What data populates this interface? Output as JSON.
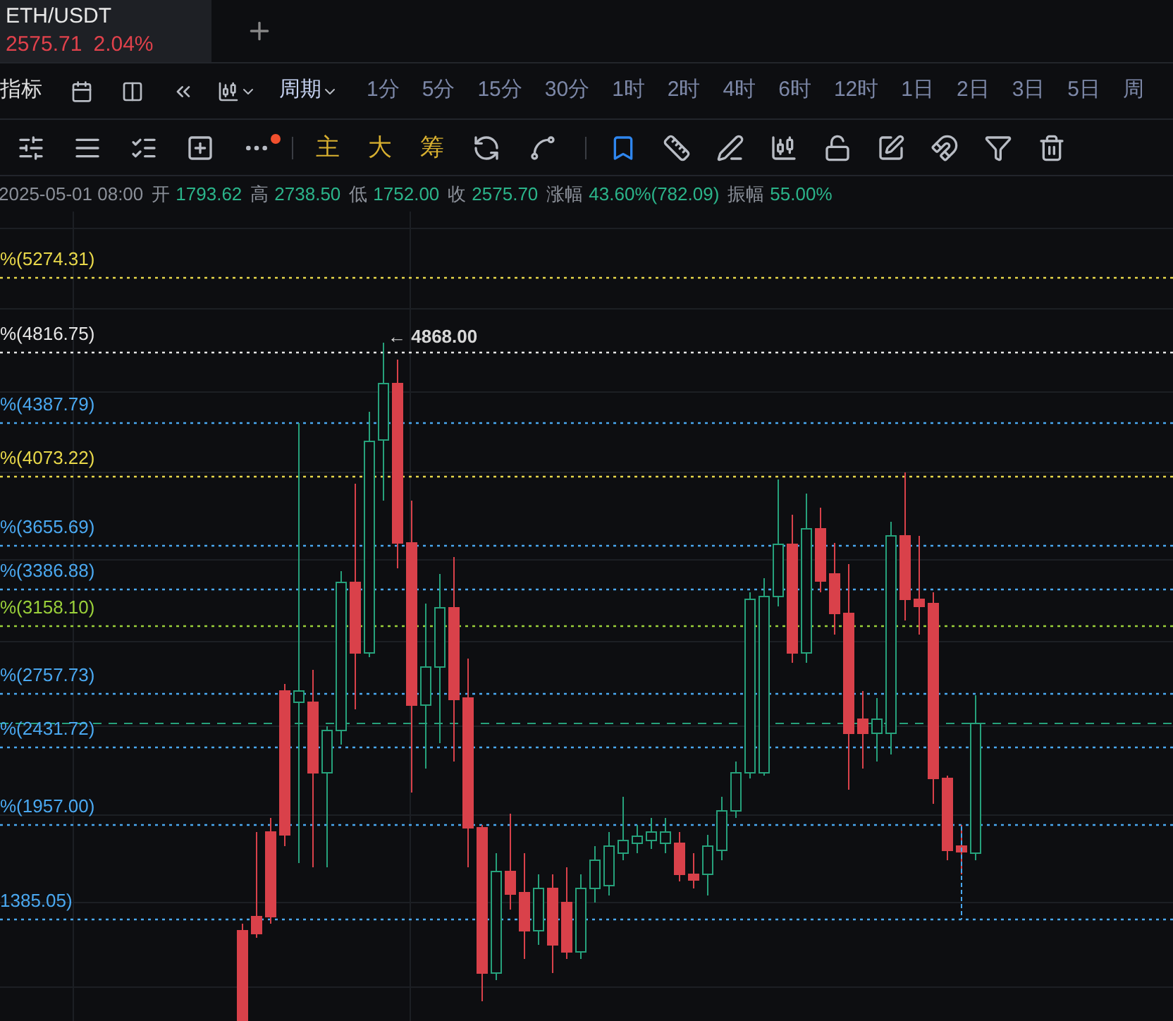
{
  "tab": {
    "symbol": "ETH/USDT",
    "price": "2575.71",
    "change": "2.04%"
  },
  "toolbar": {
    "indicator_label": "指标",
    "period_label": "周期",
    "periods": [
      {
        "label": "1分",
        "selected": false
      },
      {
        "label": "5分",
        "selected": false
      },
      {
        "label": "15分",
        "selected": false
      },
      {
        "label": "30分",
        "selected": false
      },
      {
        "label": "1时",
        "selected": false
      },
      {
        "label": "2时",
        "selected": false
      },
      {
        "label": "4时",
        "selected": false
      },
      {
        "label": "6时",
        "selected": false
      },
      {
        "label": "12时",
        "selected": false
      },
      {
        "label": "1日",
        "selected": false
      },
      {
        "label": "2日",
        "selected": false
      },
      {
        "label": "3日",
        "selected": false
      },
      {
        "label": "5日",
        "selected": false
      },
      {
        "label": "周",
        "selected": false
      }
    ]
  },
  "tools": {
    "more_has_alert": true,
    "buttons": [
      "主",
      "大",
      "筹"
    ],
    "draw_tools": [
      {
        "kind": "bookmark",
        "selected": true
      },
      {
        "kind": "ruler",
        "selected": false
      },
      {
        "kind": "pen",
        "selected": false
      },
      {
        "kind": "candles",
        "selected": false
      },
      {
        "kind": "lock",
        "selected": false
      },
      {
        "kind": "note",
        "selected": false
      },
      {
        "kind": "magnet",
        "selected": false
      },
      {
        "kind": "filter",
        "selected": false
      },
      {
        "kind": "trash",
        "selected": false
      }
    ]
  },
  "ohlc": {
    "date": "2025-05-01 08:00",
    "fields": [
      {
        "label": "开",
        "value": "1793.62"
      },
      {
        "label": "高",
        "value": "2738.50"
      },
      {
        "label": "低",
        "value": "1752.00"
      },
      {
        "label": "收",
        "value": "2575.70"
      },
      {
        "label": "涨幅",
        "value": "43.60%(782.09)"
      },
      {
        "label": "振幅",
        "value": "55.00%"
      }
    ]
  },
  "chart": {
    "peak_label": "← 4868.00",
    "levels": [
      {
        "label": "%(5274.31)",
        "color": "#e8d84a"
      },
      {
        "label": "%(4816.75)",
        "color": "#e6e6e6"
      },
      {
        "label": "%(4387.79)",
        "color": "#4aa8f0"
      },
      {
        "label": "%(4073.22)",
        "color": "#e8d84a"
      },
      {
        "label": "%(3655.69)",
        "color": "#4aa8f0"
      },
      {
        "label": "%(3386.88)",
        "color": "#4aa8f0"
      },
      {
        "label": "%(3158.10)",
        "color": "#9ad03a"
      },
      {
        "label": "%(2757.73)",
        "color": "#4aa8f0"
      },
      {
        "label": "%(2431.72)",
        "color": "#4aa8f0"
      },
      {
        "label": "%(1957.00)",
        "color": "#4aa8f0"
      },
      {
        "label": "1385.05)",
        "color": "#4aa8f0"
      }
    ]
  }
}
